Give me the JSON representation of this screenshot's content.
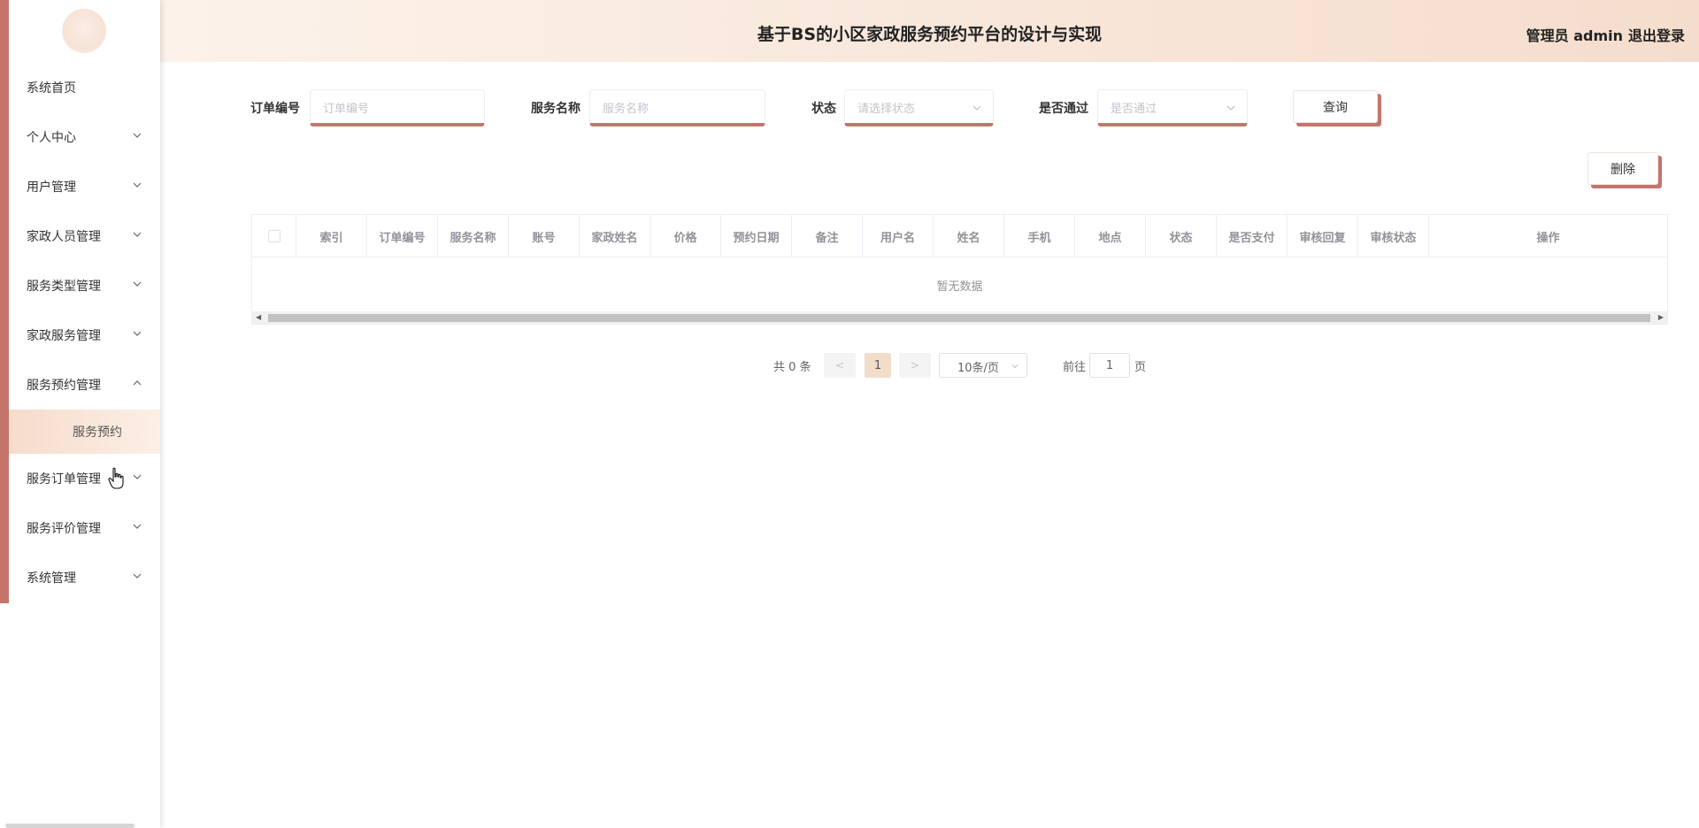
{
  "header": {
    "title": "基于BS的小区家政服务预约平台的设计与实现",
    "user": "管理员 admin",
    "logout": "退出登录"
  },
  "sidebar": {
    "items": [
      {
        "label": "系统首页",
        "has_children": false
      },
      {
        "label": "个人中心",
        "has_children": true
      },
      {
        "label": "用户管理",
        "has_children": true
      },
      {
        "label": "家政人员管理",
        "has_children": true
      },
      {
        "label": "服务类型管理",
        "has_children": true
      },
      {
        "label": "家政服务管理",
        "has_children": true
      },
      {
        "label": "服务预约管理",
        "has_children": true,
        "expanded": true
      },
      {
        "label": "服务订单管理",
        "has_children": true
      },
      {
        "label": "服务评价管理",
        "has_children": true
      },
      {
        "label": "系统管理",
        "has_children": true
      }
    ],
    "active_subitem": "服务预约"
  },
  "search": {
    "order_no_label": "订单编号",
    "order_no_placeholder": "订单编号",
    "service_name_label": "服务名称",
    "service_name_placeholder": "服务名称",
    "status_label": "状态",
    "status_placeholder": "请选择状态",
    "passed_label": "是否通过",
    "passed_placeholder": "是否通过",
    "query_button": "查询"
  },
  "actions": {
    "delete_button": "删除"
  },
  "table": {
    "columns": [
      "索引",
      "订单编号",
      "服务名称",
      "账号",
      "家政姓名",
      "价格",
      "预约日期",
      "备注",
      "用户名",
      "姓名",
      "手机",
      "地点",
      "状态",
      "是否支付",
      "审核回复",
      "审核状态",
      "操作"
    ],
    "empty_text": "暂无数据"
  },
  "pagination": {
    "total_text": "共 0 条",
    "prev": "<",
    "current_page": "1",
    "next": ">",
    "page_size": "10条/页",
    "goto_label": "前往",
    "goto_value": "1",
    "page_unit": "页"
  },
  "colors": {
    "accent": "#c4756c",
    "header_gradient_start": "#fcf2ea",
    "header_gradient_end": "#f5ddcd",
    "active_page_bg": "#f2dcca"
  },
  "icons": {
    "menu_expand": "chevron-down-icon",
    "menu_collapse": "chevron-up-icon",
    "select_arrow": "chevron-down-icon",
    "cursor": "hand-pointer-icon"
  }
}
